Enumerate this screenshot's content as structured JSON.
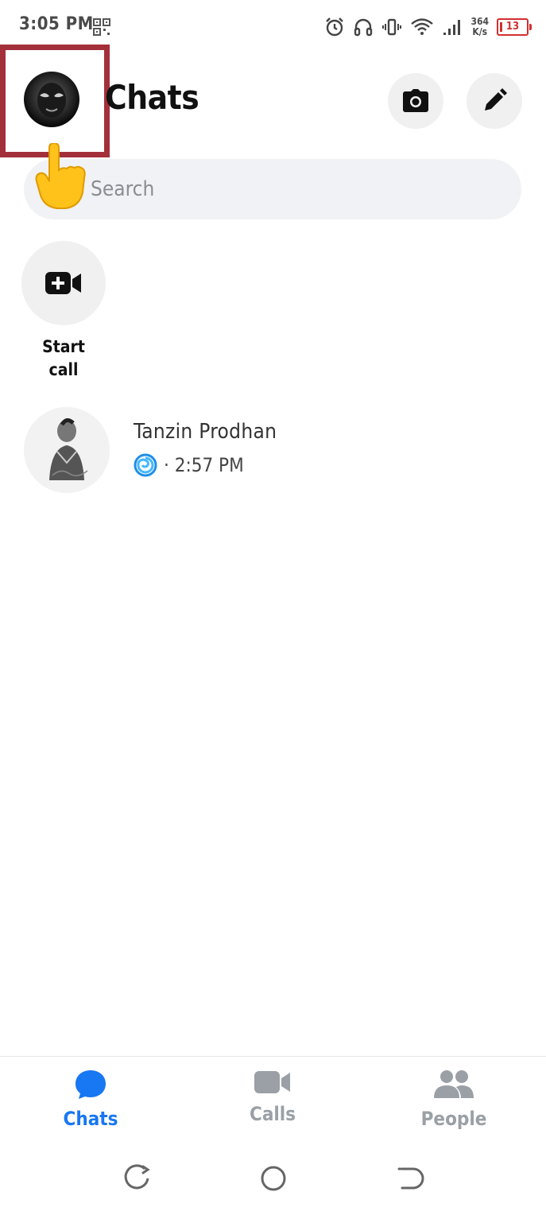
{
  "status_bar": {
    "time": "3:05 PM",
    "net_speed_value": "364",
    "net_speed_unit": "K/s",
    "battery_level": "13",
    "icons": [
      "qr-code-icon",
      "alarm-icon",
      "headphones-icon",
      "vibrate-icon",
      "wifi-icon",
      "signal-icon",
      "battery-icon"
    ]
  },
  "header": {
    "title": "Chats",
    "avatar_icon": "profile-avatar",
    "camera_icon": "camera-icon",
    "compose_icon": "pencil-icon"
  },
  "search": {
    "placeholder": "Search"
  },
  "quick_actions": {
    "start_call_line1": "Start",
    "start_call_line2": "call",
    "icon": "video-plus-icon"
  },
  "chats": [
    {
      "name": "Tanzin Prodhan",
      "time": "· 2:57 PM",
      "status_icon": "swirl-sticker-icon"
    }
  ],
  "bottom_nav": {
    "items": [
      {
        "label": "Chats",
        "icon": "chat-bubble-icon",
        "active": true
      },
      {
        "label": "Calls",
        "icon": "video-camera-icon",
        "active": false
      },
      {
        "label": "People",
        "icon": "people-icon",
        "active": false
      }
    ]
  },
  "colors": {
    "accent": "#1877f2",
    "inactive": "#9aa0a6",
    "highlight_box": "#a32f3a",
    "battery_low": "#d32f2f"
  }
}
